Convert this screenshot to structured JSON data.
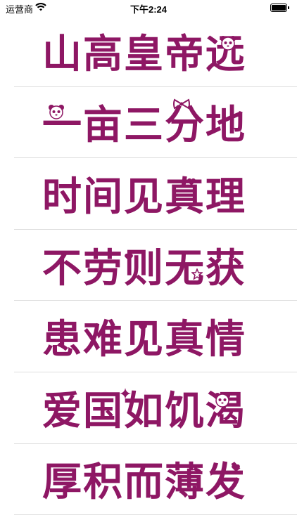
{
  "status_bar": {
    "carrier": "运营商",
    "time": "下午2:24",
    "wifi_icon": "wifi-icon",
    "battery_icon": "battery-icon"
  },
  "theme": {
    "text_color": "#8e1764",
    "separator_color": "#dedede"
  },
  "items": [
    {
      "text": "山高皇帝远"
    },
    {
      "text": "一亩三分地"
    },
    {
      "text": "时间见真理"
    },
    {
      "text": "不劳则无获"
    },
    {
      "text": "患难见真情"
    },
    {
      "text": "爱国如饥渴"
    },
    {
      "text": "厚积而薄发"
    }
  ]
}
